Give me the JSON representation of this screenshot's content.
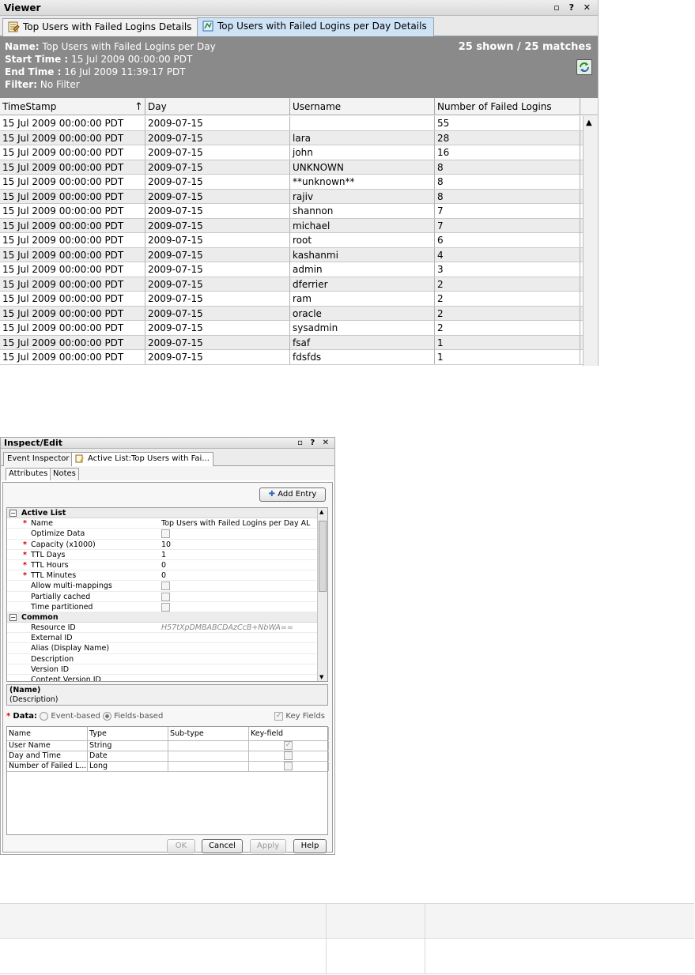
{
  "viewer": {
    "title": "Viewer",
    "window_controls": "▫ ? ✕",
    "tabs": [
      {
        "label": "Top Users with Failed Logins Details",
        "active": false
      },
      {
        "label": "Top Users with Failed Logins per Day Details",
        "active": true
      }
    ],
    "info": {
      "name_label": "Name:",
      "name_value": "Top Users with Failed Logins per Day",
      "start_label": "Start Time :",
      "start_value": "15 Jul 2009 00:00:00 PDT",
      "end_label": "End Time :",
      "end_value": "16 Jul 2009 11:39:17 PDT",
      "filter_label": "Filter:",
      "filter_value": "No Filter",
      "match_count": "25 shown / 25 matches"
    },
    "columns": [
      "TimeStamp",
      "Day",
      "Username",
      "Number of Failed Logins"
    ],
    "rows": [
      [
        "15 Jul 2009 00:00:00 PDT",
        "2009-07-15",
        "",
        "55"
      ],
      [
        "15 Jul 2009 00:00:00 PDT",
        "2009-07-15",
        "lara",
        "28"
      ],
      [
        "15 Jul 2009 00:00:00 PDT",
        "2009-07-15",
        "john",
        "16"
      ],
      [
        "15 Jul 2009 00:00:00 PDT",
        "2009-07-15",
        "UNKNOWN",
        "8"
      ],
      [
        "15 Jul 2009 00:00:00 PDT",
        "2009-07-15",
        "**unknown**",
        "8"
      ],
      [
        "15 Jul 2009 00:00:00 PDT",
        "2009-07-15",
        "rajiv",
        "8"
      ],
      [
        "15 Jul 2009 00:00:00 PDT",
        "2009-07-15",
        "shannon",
        "7"
      ],
      [
        "15 Jul 2009 00:00:00 PDT",
        "2009-07-15",
        "michael",
        "7"
      ],
      [
        "15 Jul 2009 00:00:00 PDT",
        "2009-07-15",
        "root",
        "6"
      ],
      [
        "15 Jul 2009 00:00:00 PDT",
        "2009-07-15",
        "kashanmi",
        "4"
      ],
      [
        "15 Jul 2009 00:00:00 PDT",
        "2009-07-15",
        "admin",
        "3"
      ],
      [
        "15 Jul 2009 00:00:00 PDT",
        "2009-07-15",
        "dferrier",
        "2"
      ],
      [
        "15 Jul 2009 00:00:00 PDT",
        "2009-07-15",
        "ram",
        "2"
      ],
      [
        "15 Jul 2009 00:00:00 PDT",
        "2009-07-15",
        "oracle",
        "2"
      ],
      [
        "15 Jul 2009 00:00:00 PDT",
        "2009-07-15",
        "sysadmin",
        "2"
      ],
      [
        "15 Jul 2009 00:00:00 PDT",
        "2009-07-15",
        "fsaf",
        "1"
      ],
      [
        "15 Jul 2009 00:00:00 PDT",
        "2009-07-15",
        "fdsfds",
        "1"
      ]
    ]
  },
  "inspect": {
    "title": "Inspect/Edit",
    "window_controls": "▫ ? ✕",
    "tabs": [
      "Event Inspector",
      "Active List:Top Users with Fai..."
    ],
    "subtabs": [
      "Attributes",
      "Notes"
    ],
    "add_entry_label": "Add Entry",
    "sections": [
      {
        "label": "Active List",
        "props": [
          {
            "label": "Name",
            "required": true,
            "value": "Top Users with Failed Logins per Day AL",
            "kind": "text"
          },
          {
            "label": "Optimize Data",
            "required": false,
            "value": "",
            "kind": "checkbox"
          },
          {
            "label": "Capacity (x1000)",
            "required": true,
            "value": "10",
            "kind": "text"
          },
          {
            "label": "TTL Days",
            "required": true,
            "value": "1",
            "kind": "text"
          },
          {
            "label": "TTL Hours",
            "required": true,
            "value": "0",
            "kind": "text"
          },
          {
            "label": "TTL Minutes",
            "required": true,
            "value": "0",
            "kind": "text"
          },
          {
            "label": "Allow multi-mappings",
            "required": false,
            "value": "",
            "kind": "checkbox"
          },
          {
            "label": "Partially cached",
            "required": false,
            "value": "",
            "kind": "checkbox"
          },
          {
            "label": "Time partitioned",
            "required": false,
            "value": "",
            "kind": "checkbox"
          }
        ]
      },
      {
        "label": "Common",
        "props": [
          {
            "label": "Resource ID",
            "required": false,
            "value": "H57tXpDMBABCDAzCcB+NbWA==",
            "kind": "readonly"
          },
          {
            "label": "External ID",
            "required": false,
            "value": "",
            "kind": "text"
          },
          {
            "label": "Alias (Display Name)",
            "required": false,
            "value": "",
            "kind": "text"
          },
          {
            "label": "Description",
            "required": false,
            "value": "",
            "kind": "text"
          },
          {
            "label": "Version ID",
            "required": false,
            "value": "",
            "kind": "text"
          },
          {
            "label": "Content Version ID",
            "required": false,
            "value": "",
            "kind": "text"
          }
        ]
      }
    ],
    "desc_title": "(Name)",
    "desc_text": "(Description)",
    "data_label": "Data:",
    "radio_event": "Event-based",
    "radio_fields": "Fields-based",
    "key_fields_label": "Key Fields",
    "field_columns": [
      "Name",
      "Type",
      "Sub-type",
      "Key-field"
    ],
    "field_rows": [
      {
        "name": "User Name",
        "type": "String",
        "subtype": "",
        "key": true
      },
      {
        "name": "Day and Time",
        "type": "Date",
        "subtype": "",
        "key": false
      },
      {
        "name": "Number of Failed L...",
        "type": "Long",
        "subtype": "",
        "key": false
      }
    ],
    "buttons": {
      "ok": "OK",
      "cancel": "Cancel",
      "apply": "Apply",
      "help": "Help"
    }
  },
  "colors": {
    "active_tab": "#cfe3f6",
    "info_panel": "#8a8a8a",
    "required": "#d40000"
  }
}
